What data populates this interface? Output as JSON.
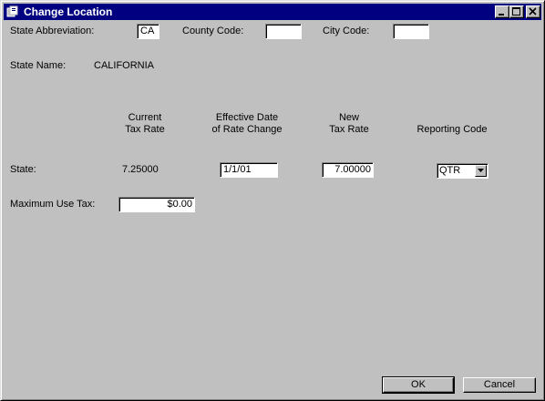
{
  "window": {
    "title": "Change Location",
    "icon": "app-icon",
    "controls": [
      "minimize-icon",
      "maximize-icon",
      "close-icon"
    ]
  },
  "location": {
    "state_abbreviation_label": "State Abbreviation:",
    "state_abbreviation_value": "CA",
    "county_code_label": "County Code:",
    "county_code_value": "",
    "city_code_label": "City Code:",
    "city_code_value": "",
    "state_name_label": "State Name:",
    "state_name_value": "CALIFORNIA"
  },
  "headers": {
    "current_rate_line1": "Current",
    "current_rate_line2": "Tax Rate",
    "effective_date_line1": "Effective Date",
    "effective_date_line2": "of Rate Change",
    "new_rate_line1": "New",
    "new_rate_line2": "Tax Rate",
    "reporting_code": "Reporting Code"
  },
  "state_row": {
    "label": "State:",
    "current_rate": "7.25000",
    "effective_date": "1/1/01",
    "new_rate": "7.00000",
    "reporting_code": "QTR"
  },
  "use_tax": {
    "label": "Maximum Use Tax:",
    "value": "$0.00"
  },
  "buttons": {
    "ok": "OK",
    "cancel": "Cancel"
  },
  "colors": {
    "titlebar": "#000080",
    "face": "#c0c0c0",
    "field": "#ffffff"
  }
}
